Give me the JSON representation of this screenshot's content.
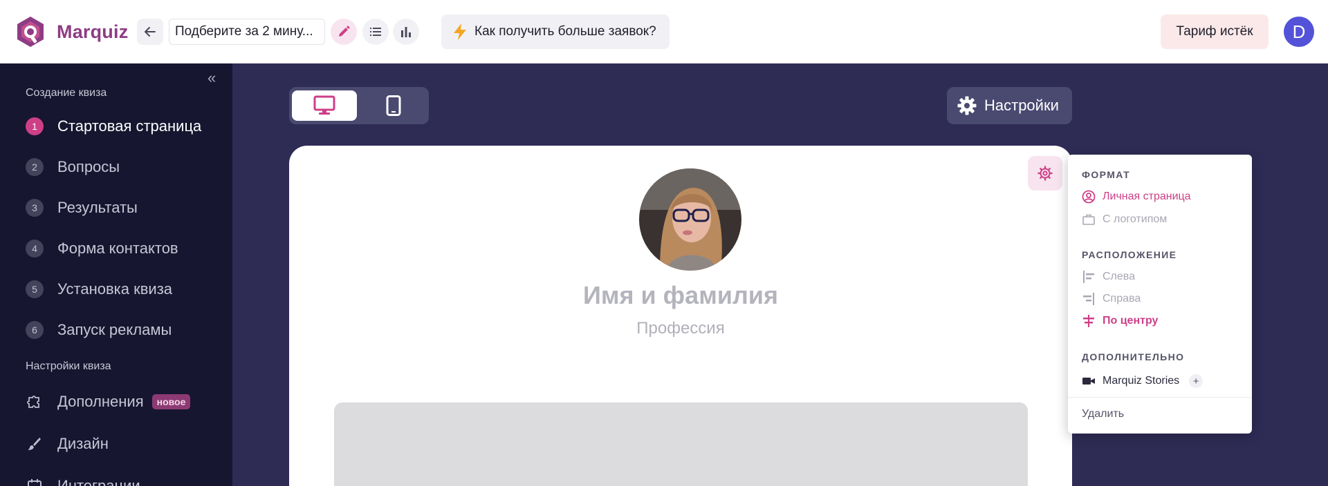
{
  "app": {
    "logo_text": "Marquiz"
  },
  "topbar": {
    "quiz_name": "Подберите за 2 мину...",
    "tip_label": "Как получить больше заявок?",
    "tariff_label": "Тариф истёк",
    "avatar_letter": "D"
  },
  "sidebar": {
    "section_create": "Создание квиза",
    "steps": [
      {
        "num": "1",
        "label": "Стартовая страница",
        "active": true
      },
      {
        "num": "2",
        "label": "Вопросы"
      },
      {
        "num": "3",
        "label": "Результаты"
      },
      {
        "num": "4",
        "label": "Форма контактов"
      },
      {
        "num": "5",
        "label": "Установка квиза"
      },
      {
        "num": "6",
        "label": "Запуск рекламы"
      }
    ],
    "section_settings": "Настройки квиза",
    "settings_items": [
      {
        "label": "Дополнения",
        "badge": "новое",
        "icon": "puzzle-icon"
      },
      {
        "label": "Дизайн",
        "icon": "brush-icon"
      },
      {
        "label": "Интеграции",
        "icon": "calendar-icon"
      }
    ]
  },
  "workspace": {
    "settings_label": "Настройки",
    "person_name": "Имя и фамилия",
    "person_profession": "Профессия"
  },
  "popup": {
    "format_heading": "ФОРМАТ",
    "format_personal": "Личная страница",
    "format_logo": "С логотипом",
    "layout_heading": "РАСПОЛОЖЕНИЕ",
    "layout_left": "Слева",
    "layout_right": "Справа",
    "layout_center": "По центру",
    "extra_heading": "ДОПОЛНИТЕЛЬНО",
    "extra_stories": "Marquiz Stories",
    "delete_label": "Удалить"
  },
  "colors": {
    "accent": "#cd3f87",
    "sidebar_bg": "#161630",
    "workspace_bg": "#2e2c55",
    "brand": "#8e3c84"
  }
}
